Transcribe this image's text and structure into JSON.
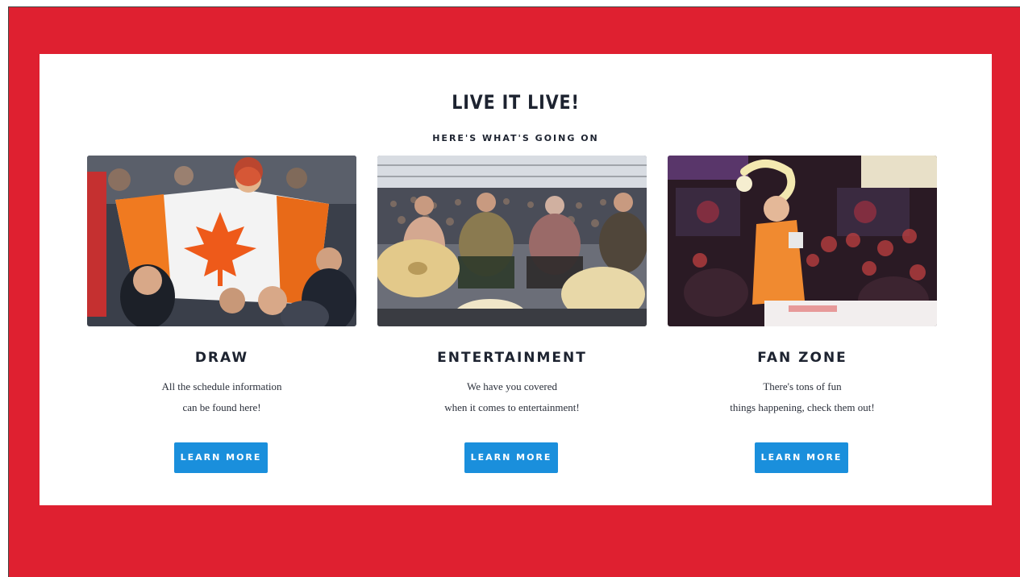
{
  "section": {
    "title": "LIVE IT LIVE!",
    "subtitle": "HERE'S WHAT'S GOING ON"
  },
  "colors": {
    "background_red": "#df2030",
    "panel": "#ffffff",
    "button_blue": "#1a8fdc",
    "heading": "#1d2330"
  },
  "cards": [
    {
      "title": "DRAW",
      "line1": "All the schedule information",
      "line2": "can be found here!",
      "button": "LEARN MORE",
      "image": "canadian-flag-fans-photo"
    },
    {
      "title": "ENTERTAINMENT",
      "line1": "We have you covered",
      "line2": "when it comes to entertainment!",
      "button": "LEARN MORE",
      "image": "concert-crowd-drums-photo"
    },
    {
      "title": "FAN ZONE",
      "line1": "There's tons of fun",
      "line2": "things happening, check them out!",
      "button": "LEARN MORE",
      "image": "fan-zone-balloon-performer-photo"
    }
  ]
}
